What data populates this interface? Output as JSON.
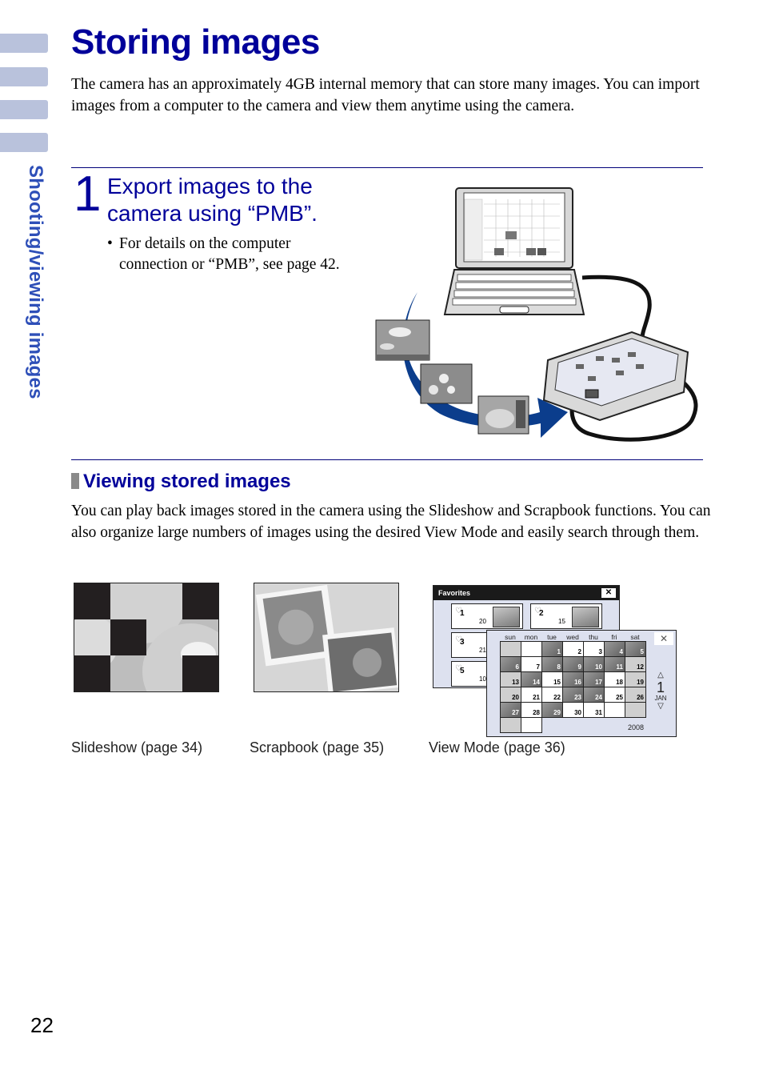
{
  "sidebar": {
    "section_label": "Shooting/viewing images"
  },
  "page": {
    "title": "Storing images",
    "intro": "The camera has an approximately 4GB internal memory that can store many images. You can import images from a computer to the camera and view them anytime using the camera.",
    "page_number": "22"
  },
  "step1": {
    "number": "1",
    "title_line1": "Export images to the",
    "title_line2": "camera using “PMB”.",
    "note_bullet": "•",
    "note_line1": "For details on the computer",
    "note_line2": "connection or “PMB”, see page 42."
  },
  "viewing": {
    "heading": "Viewing stored images",
    "body": "You can play back images stored in the camera using the Slideshow and Scrapbook functions. You can also organize large numbers of images using the desired View Mode and easily search through them."
  },
  "captions": {
    "slideshow": "Slideshow (page 34)",
    "scrapbook": "Scrapbook (page 35)",
    "viewmode": "View Mode (page 36)"
  },
  "favorites": {
    "title": "Favorites",
    "close": "✕",
    "items": [
      {
        "num": "1",
        "count": "20"
      },
      {
        "num": "2",
        "count": "15"
      },
      {
        "num": "3",
        "count": "21"
      },
      {
        "num": "5",
        "count": "10"
      }
    ]
  },
  "calendar": {
    "days": [
      "sun",
      "mon",
      "tue",
      "wed",
      "thu",
      "fri",
      "sat"
    ],
    "close": "✕",
    "up": "△",
    "down": "▽",
    "day": "1",
    "month": "JAN",
    "year": "2008"
  },
  "colors": {
    "heading_blue": "#00009a",
    "sidebar_tab": "#b9c2dc",
    "sidebar_text": "#2e4fb8",
    "arrow_blue": "#0b3d8c"
  }
}
